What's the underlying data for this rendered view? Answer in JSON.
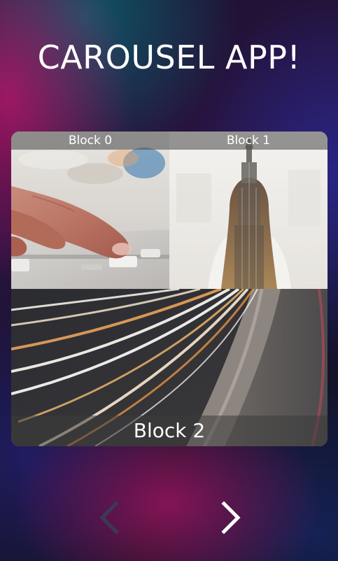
{
  "app": {
    "title": "CAROUSEL APP!"
  },
  "carousel": {
    "blocks": [
      {
        "label": "Block 0",
        "image": "hand-on-mixer-fader-photo"
      },
      {
        "label": "Block 1",
        "image": "woman-double-exposure-skyscraper-photo"
      },
      {
        "label": "Block 2",
        "image": "highway-light-trails-photo"
      }
    ]
  },
  "navigation": {
    "prev_icon": "chevron-left-icon",
    "prev_enabled": false,
    "next_icon": "chevron-right-icon",
    "next_enabled": true
  },
  "colors": {
    "title_text": "#ffffff",
    "nav_enabled": "#ffffff",
    "nav_disabled": "#3a3a55"
  }
}
